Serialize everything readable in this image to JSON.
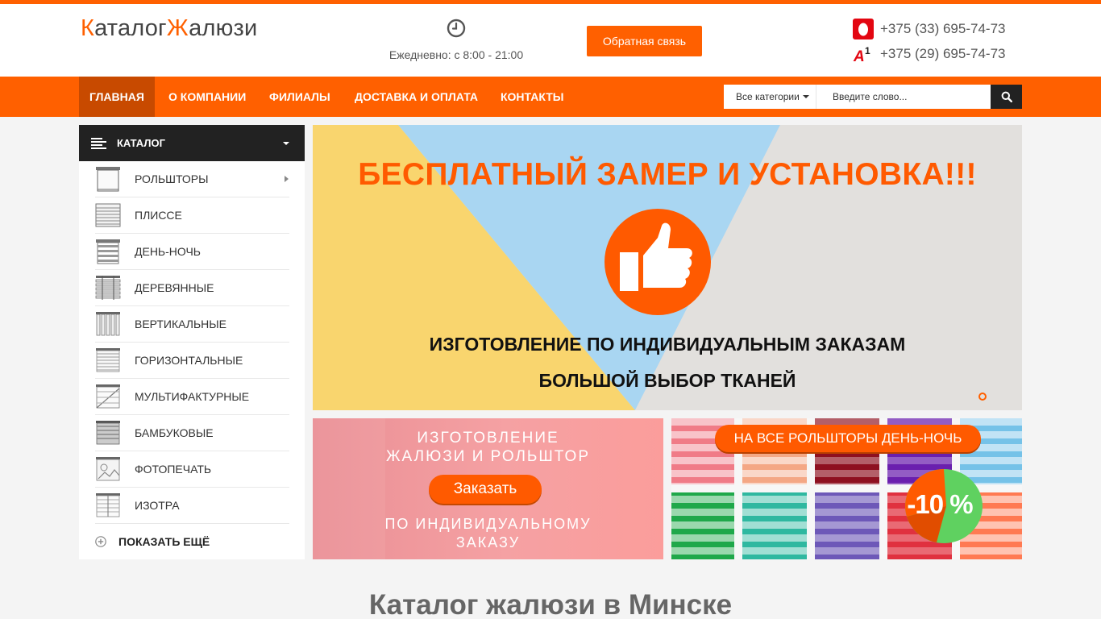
{
  "header": {
    "logo": {
      "letter1": "К",
      "part1": "аталог",
      "letter2": "Ж",
      "part2": "алюзи"
    },
    "hours": "Ежедневно: с 8:00 - 21:00",
    "feedback_label": "Обратная связь",
    "phones": [
      {
        "operator_icon": "mts-icon",
        "number": "+375 (33) 695-74-73"
      },
      {
        "operator_icon": "a1-icon",
        "number": "+375 (29) 695-74-73"
      }
    ]
  },
  "nav": {
    "items": [
      "Главная",
      "О компании",
      "Филиалы",
      "Доставка и оплата",
      "Контакты"
    ],
    "active_index": 0
  },
  "search": {
    "category": "Все категории",
    "placeholder": "Введите слово..."
  },
  "catalog": {
    "title": "Каталог",
    "items": [
      "Рольшторы",
      "Плиссе",
      "День-Ночь",
      "Деревянные",
      "Вертикальные",
      "Горизонтальные",
      "Мультифактурные",
      "Бамбуковые",
      "Фотопечать",
      "Изотра"
    ],
    "more_label": "Показать ещё"
  },
  "hero": {
    "title": "БЕСПЛАТНЫЙ ЗАМЕР И УСТАНОВКА!!!",
    "line1": "ИЗГОТОВЛЕНИЕ ПО ИНДИВИДУАЛЬНЫМ ЗАКАЗАМ",
    "line2": "БОЛЬШОЙ ВЫБОР ТКАНЕЙ"
  },
  "banner_left": {
    "top_line1": "Изготовление",
    "top_line2": "жалюзи и рольштор",
    "button": "Заказать",
    "bottom_line1": "по индивидуальному",
    "bottom_line2": "заказу"
  },
  "banner_right": {
    "pill": "На все рольшторы день-ночь",
    "discount": "-10 %"
  },
  "page_heading": "Каталог жалюзи в Минске",
  "colors": {
    "accent": "#ff6000",
    "nav_active": "#c84a00",
    "dark": "#222222"
  }
}
